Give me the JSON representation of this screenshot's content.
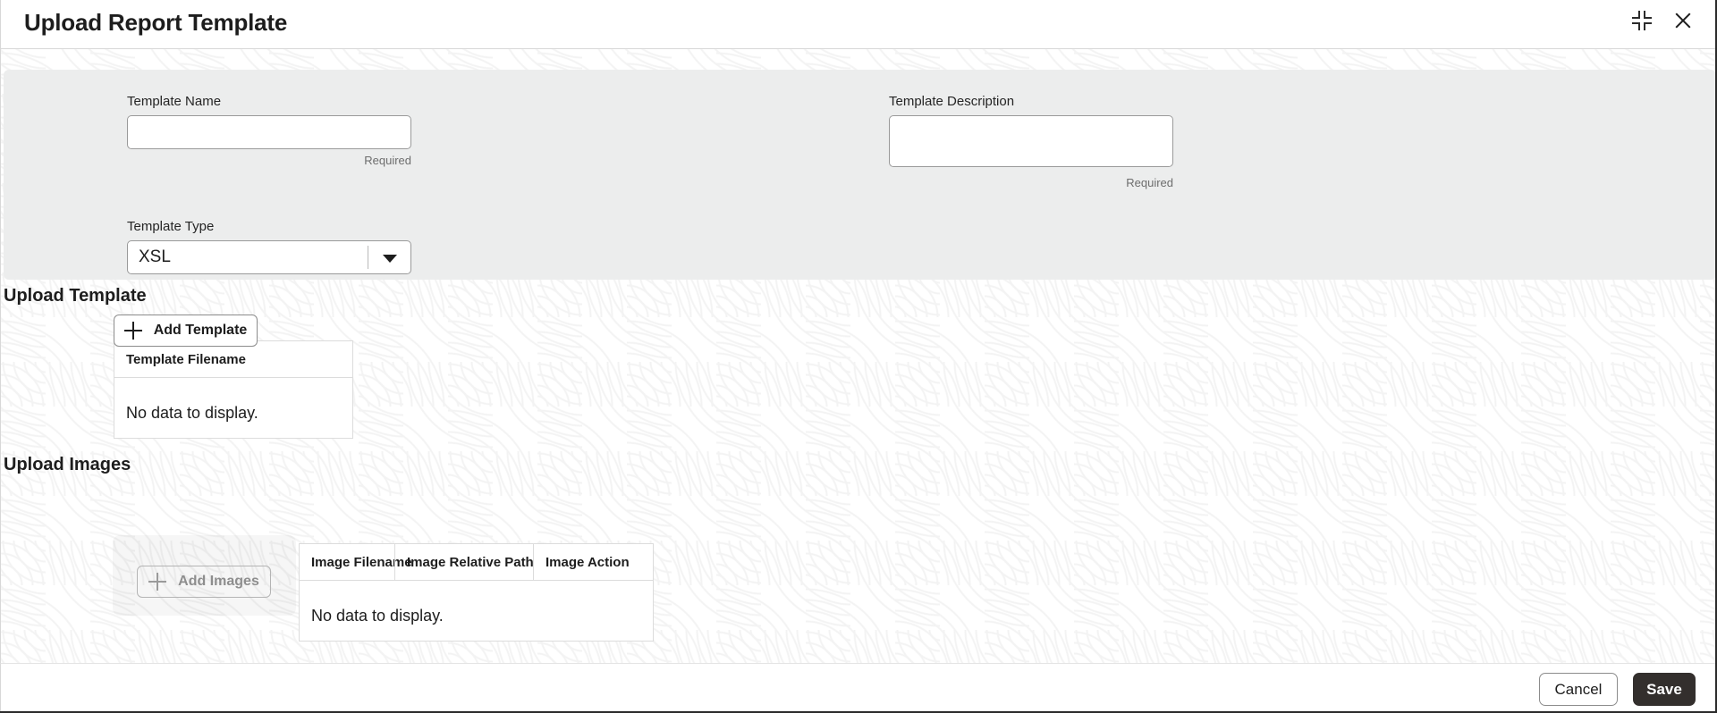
{
  "dialog": {
    "title": "Upload Report Template",
    "collapse_icon": "collapse-icon",
    "close_icon": "close-icon"
  },
  "form": {
    "template_name": {
      "label": "Template Name",
      "value": "",
      "placeholder": "",
      "hint": "Required"
    },
    "template_description": {
      "label": "Template Description",
      "value": "",
      "placeholder": "",
      "hint": "Required"
    },
    "template_type": {
      "label": "Template Type",
      "value": "XSL",
      "options": [
        "XSL"
      ],
      "caret_icon": "chevron-down-icon"
    }
  },
  "upload_template": {
    "section_title": "Upload Template",
    "add_button": {
      "label": "Add Template",
      "icon": "plus-icon",
      "disabled": false
    },
    "table": {
      "columns": [
        "Template Filename"
      ],
      "rows": [],
      "empty_text": "No data to display."
    }
  },
  "upload_images": {
    "section_title": "Upload Images",
    "add_button": {
      "label": "Add Images",
      "icon": "plus-icon",
      "disabled": true
    },
    "table": {
      "columns": [
        "Image Filename",
        "Image Relative Path",
        "Image Action"
      ],
      "rows": [],
      "empty_text": "No data to display."
    }
  },
  "footer": {
    "cancel_label": "Cancel",
    "save_label": "Save"
  },
  "colors": {
    "panel_bg": "#eceded",
    "save_bg": "#332f2d",
    "text": "#1d1d1d",
    "hint": "#6d6d6d",
    "border": "#dcdcdc"
  }
}
